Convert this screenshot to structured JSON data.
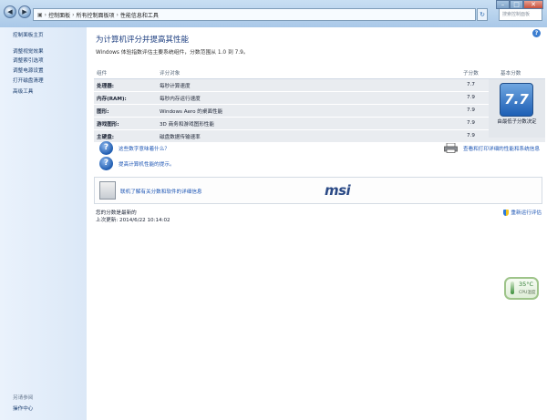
{
  "address": {
    "crumbs": [
      "控制面板",
      "所有控制面板项",
      "性能信息和工具"
    ],
    "search_placeholder": "搜索控制面板"
  },
  "sidebar": {
    "home": "控制面板主页",
    "items": [
      "调整视觉效果",
      "调整索引选项",
      "调整电源设置",
      "打开磁盘清理",
      "高级工具"
    ],
    "see_also_header": "另请参阅",
    "see_also_items": [
      "操作中心"
    ]
  },
  "main": {
    "title": "为计算机评分并提高其性能",
    "subtitle": "Windows 体验指数评估主要系统组件，分数范围从 1.0 到 7.9。",
    "table": {
      "headers": [
        "组件",
        "评分对象",
        "子分数",
        "基本分数"
      ],
      "rows": [
        {
          "component": "处理器:",
          "object": "每秒计算速度",
          "score": "7.7"
        },
        {
          "component": "内存(RAM):",
          "object": "每秒内存运行速度",
          "score": "7.9"
        },
        {
          "component": "图形:",
          "object": "Windows Aero 的桌面性能",
          "score": "7.9"
        },
        {
          "component": "游戏图形:",
          "object": "3D 商务和游戏图形性能",
          "score": "7.9"
        },
        {
          "component": "主硬盘:",
          "object": "磁盘数据传输速率",
          "score": "7.9"
        }
      ],
      "base_score": "7.7",
      "base_caption": "由最低子分数决定"
    },
    "links": {
      "what_scores_mean": "这些数字意味着什么？",
      "improve_tips": "提高计算机性能的提示。",
      "view_print": "查看和打印详细的性能和系统信息"
    },
    "promo_link": "联机了解有关分数和软件的详细信息",
    "promo_logo": "msi",
    "status_current": "您的分数是最新的",
    "status_last_update": "上次更新: 2014/6/22 10:14:02",
    "rerun": "重新运行评估"
  },
  "gadget": {
    "temp": "35°C",
    "label": "CPU温度"
  },
  "colors": {
    "link": "#1c55b4",
    "title": "#1e3f80",
    "badge": "#1d5fb5"
  }
}
